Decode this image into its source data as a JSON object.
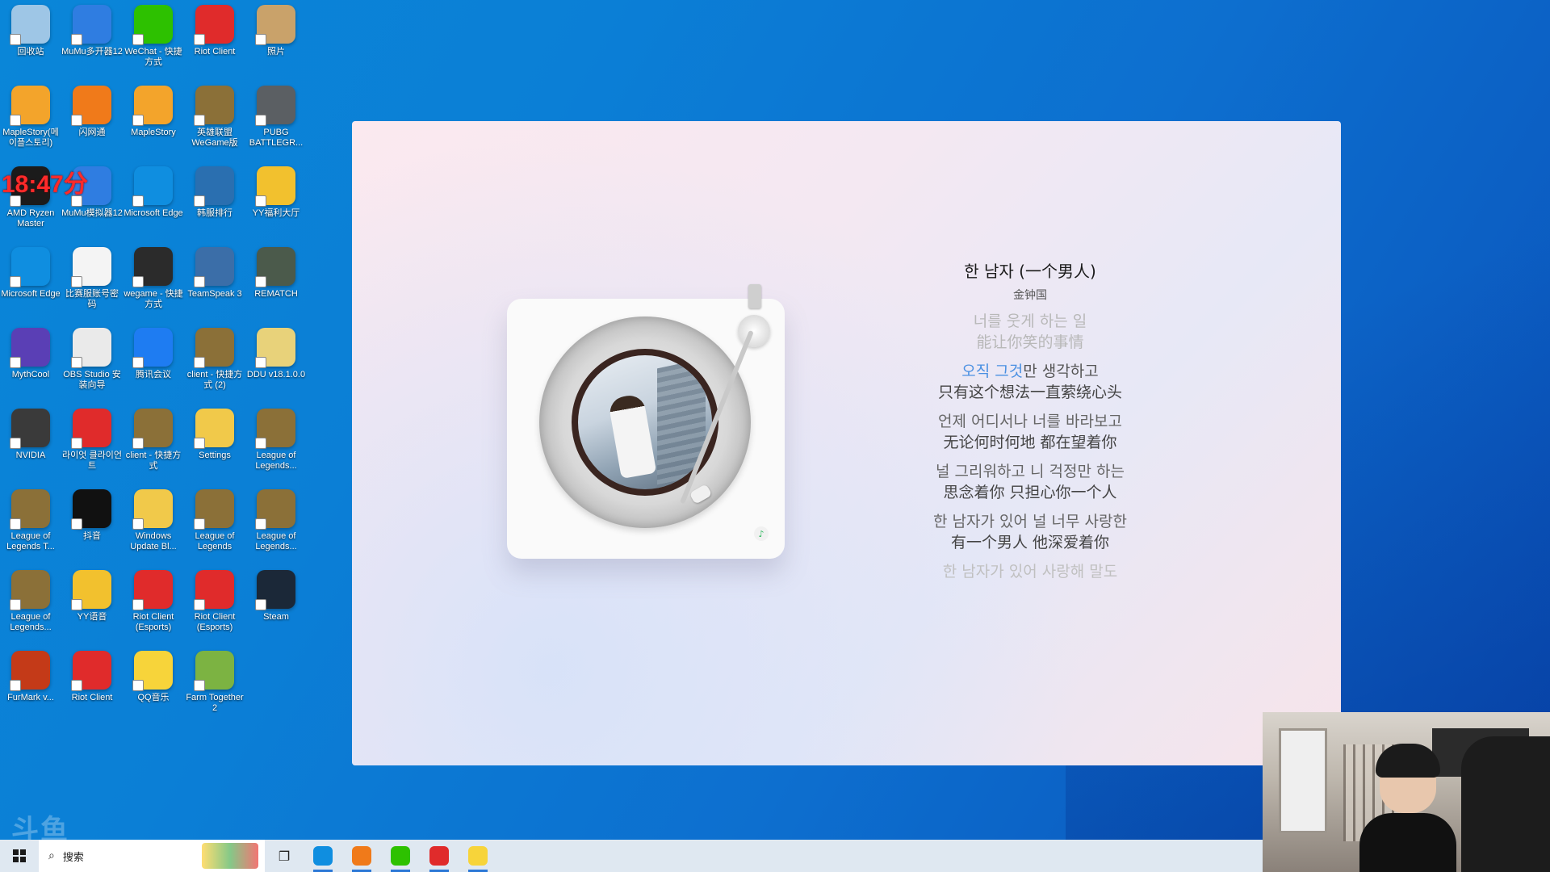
{
  "desktop": {
    "icons": [
      {
        "label": "回收站",
        "color": "#9ec6e6",
        "icon": "recycle-bin-icon"
      },
      {
        "label": "MuMu多开器12",
        "color": "#2f7de1",
        "icon": "mumu-multi-icon"
      },
      {
        "label": "WeChat - 快捷方式",
        "color": "#2dc100",
        "icon": "wechat-icon"
      },
      {
        "label": "Riot Client",
        "color": "#e02b2b",
        "icon": "riot-client-icon"
      },
      {
        "label": "照片",
        "color": "#c9a26a",
        "icon": "photos-icon"
      },
      {
        "label": "MapleStory(메이플스토리)",
        "color": "#f3a42b",
        "icon": "maplestory-icon"
      },
      {
        "label": "闪网通",
        "color": "#f07a1a",
        "icon": "shanwangtong-icon"
      },
      {
        "label": "MapleStory",
        "color": "#f3a42b",
        "icon": "maplestory-icon"
      },
      {
        "label": "英雄联盟WeGame版",
        "color": "#8b7038",
        "icon": "lol-wegame-icon"
      },
      {
        "label": "PUBG BATTLEGR...",
        "color": "#5b5f63",
        "icon": "pubg-icon"
      },
      {
        "label": "AMD Ryzen Master",
        "color": "#1b1b1b",
        "icon": "amd-ryzen-icon"
      },
      {
        "label": "MuMu模拟器12",
        "color": "#2f7de1",
        "icon": "mumu-emulator-icon"
      },
      {
        "label": "Microsoft Edge",
        "color": "#0f8ee0",
        "icon": "edge-icon"
      },
      {
        "label": "韩服排行",
        "color": "#2a6fb0",
        "icon": "ranking-icon"
      },
      {
        "label": "YY福利大厅",
        "color": "#f2c12e",
        "icon": "yy-welfare-icon"
      },
      {
        "label": "Microsoft Edge",
        "color": "#0f8ee0",
        "icon": "edge-icon"
      },
      {
        "label": "比赛服账号密码",
        "color": "#f4f4f4",
        "icon": "text-file-icon"
      },
      {
        "label": "wegame - 快捷方式",
        "color": "#2b2b2b",
        "icon": "wegame-icon"
      },
      {
        "label": "TeamSpeak 3",
        "color": "#3b6ea8",
        "icon": "teamspeak-icon"
      },
      {
        "label": "REMATCH",
        "color": "#4b5a4b",
        "icon": "rematch-icon"
      },
      {
        "label": "MythCool",
        "color": "#5a3fb5",
        "icon": "mythcool-icon"
      },
      {
        "label": "OBS Studio 安装向导",
        "color": "#eaeaea",
        "icon": "obs-setup-icon"
      },
      {
        "label": "腾讯会议",
        "color": "#1e7cf2",
        "icon": "tencent-meeting-icon"
      },
      {
        "label": "client - 快捷方式 (2)",
        "color": "#8b7038",
        "icon": "lol-client-icon"
      },
      {
        "label": "DDU v18.1.0.0",
        "color": "#e8d27a",
        "icon": "ddu-icon"
      },
      {
        "label": "NVIDIA",
        "color": "#3a3a3a",
        "icon": "nvidia-icon"
      },
      {
        "label": "라이엇 클라이언트",
        "color": "#e02b2b",
        "icon": "riot-client-icon"
      },
      {
        "label": "client - 快捷方式",
        "color": "#8b7038",
        "icon": "lol-client-icon"
      },
      {
        "label": "Settings",
        "color": "#f1c94a",
        "icon": "folder-icon"
      },
      {
        "label": "League of Legends...",
        "color": "#8b7038",
        "icon": "lol-icon"
      },
      {
        "label": "League of Legends T...",
        "color": "#8b7038",
        "icon": "lol-icon"
      },
      {
        "label": "抖音",
        "color": "#111111",
        "icon": "douyin-icon"
      },
      {
        "label": "Windows Update Bl...",
        "color": "#f1c94a",
        "icon": "folder-icon"
      },
      {
        "label": "League of Legends",
        "color": "#8b7038",
        "icon": "lol-icon"
      },
      {
        "label": "League of Legends...",
        "color": "#8b7038",
        "icon": "lol-icon"
      },
      {
        "label": "League of Legends...",
        "color": "#8b7038",
        "icon": "lol-icon"
      },
      {
        "label": "YY语音",
        "color": "#f2c12e",
        "icon": "yy-voice-icon"
      },
      {
        "label": "Riot Client (Esports)",
        "color": "#e02b2b",
        "icon": "riot-client-icon"
      },
      {
        "label": "Riot Client (Esports)",
        "color": "#e02b2b",
        "icon": "riot-client-icon"
      },
      {
        "label": "Steam",
        "color": "#1b2838",
        "icon": "steam-icon"
      },
      {
        "label": "FurMark v...",
        "color": "#c43a18",
        "icon": "furmark-icon"
      },
      {
        "label": "Riot Client",
        "color": "#e02b2b",
        "icon": "riot-client-icon"
      },
      {
        "label": "QQ音乐",
        "color": "#f7d43a",
        "icon": "qq-music-icon"
      },
      {
        "label": "Farm Together 2",
        "color": "#7cb342",
        "icon": "farm-together-icon"
      }
    ],
    "overlay_text": "18:47分",
    "watermark": "斗鱼"
  },
  "player": {
    "song_title": "한 남자 (一个男人)",
    "artist": "金钟国",
    "lyrics": [
      {
        "ko": "너를 웃게 하는 일",
        "zh": "能让你笑的事情",
        "state": "faded"
      },
      {
        "ko_highlight": "오직 그것",
        "ko": "만 생각하고",
        "zh": "只有这个想法一直萦绕心头",
        "state": "active"
      },
      {
        "ko": "언제 어디서나 너를 바라보고",
        "zh": "无论何时何地 都在望着你",
        "state": "normal"
      },
      {
        "ko": "널 그리워하고 니 걱정만 하는",
        "zh": "思念着你 只担心你一个人",
        "state": "normal"
      },
      {
        "ko": "한 남자가 있어 널 너무 사랑한",
        "zh": "有一个男人 他深爱着你",
        "state": "normal"
      },
      {
        "ko": "한 남자가 있어 사랑해 말도",
        "zh": "",
        "state": "fadeout"
      }
    ],
    "badge_icon": "qq-music-badge-icon"
  },
  "taskbar": {
    "search_placeholder": "搜索",
    "apps": [
      {
        "name": "edge-taskbar",
        "color": "#0f8ee0"
      },
      {
        "name": "app-orange-taskbar",
        "color": "#f07a1a"
      },
      {
        "name": "wechat-taskbar",
        "color": "#2dc100"
      },
      {
        "name": "riot-taskbar",
        "color": "#e02b2b"
      },
      {
        "name": "qq-music-taskbar",
        "color": "#f7d43a"
      }
    ]
  }
}
